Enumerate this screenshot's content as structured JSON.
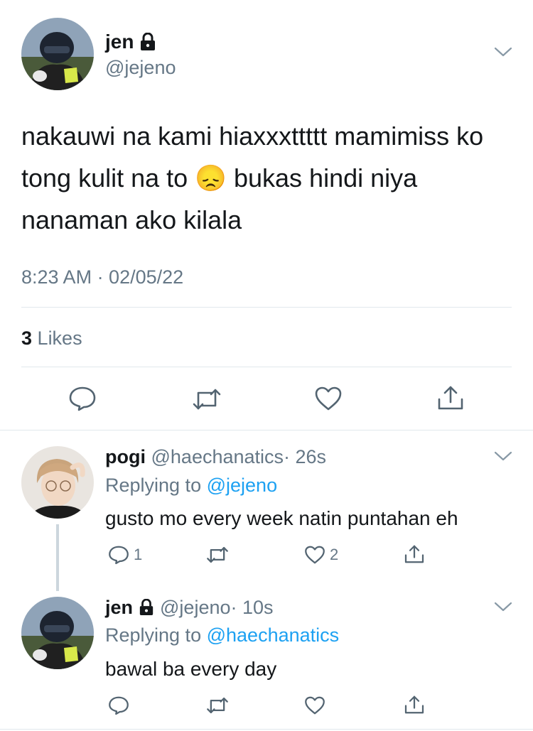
{
  "main_tweet": {
    "display_name": "jen",
    "handle": "@jejeno",
    "text": "nakauwi na kami hiaxxxttttt mamimiss ko tong kulit na to 😞 bukas hindi niya nanaman ako kilala",
    "timestamp": "8:23 AM · 02/05/22",
    "likes_count": "3",
    "likes_label": "Likes"
  },
  "replies": [
    {
      "display_name": "pogi",
      "handle": "@haechanatics",
      "time": "· 26s",
      "replying_prefix": "Replying to",
      "replying_to": "@jejeno",
      "text": "gusto mo every week natin puntahan eh",
      "reply_count": "1",
      "like_count": "2"
    },
    {
      "display_name": "jen",
      "handle": "@jejeno",
      "time": "· 10s",
      "replying_prefix": "Replying to",
      "replying_to": "@haechanatics",
      "text": "bawal ba every day",
      "reply_count": "",
      "like_count": ""
    }
  ],
  "colors": {
    "accent": "#1da1f2",
    "muted_text": "#657786",
    "icon": "#536471",
    "divider": "#e1e8ed"
  },
  "icons": [
    "lock-icon",
    "chevron-down-icon",
    "reply-icon",
    "retweet-icon",
    "like-icon",
    "share-icon"
  ]
}
